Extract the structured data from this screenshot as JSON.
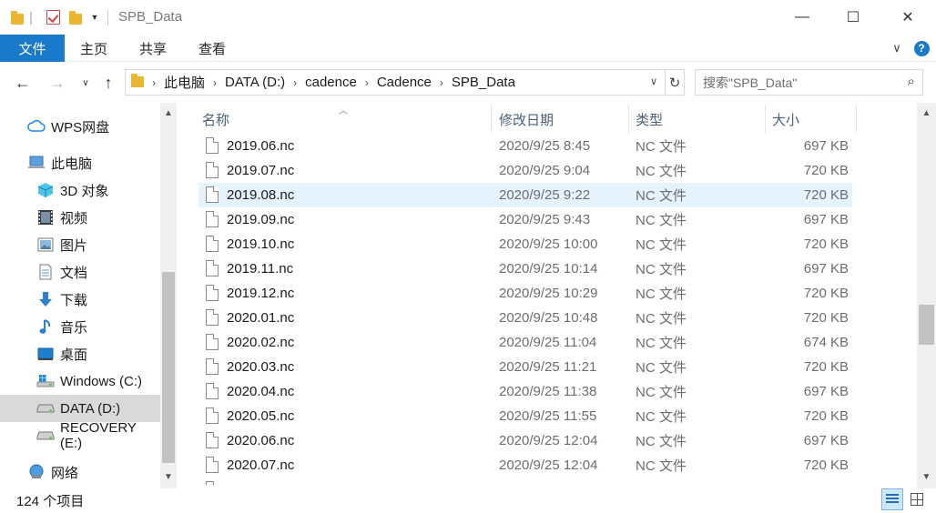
{
  "window": {
    "title": "SPB_Data",
    "minimize": "—",
    "maximize": "☐",
    "close": "✕"
  },
  "ribbon": {
    "file_tab": "文件",
    "tabs": [
      "主页",
      "共享",
      "查看"
    ],
    "expand": "∨",
    "help": "?"
  },
  "address": {
    "segments": [
      "此电脑",
      "DATA (D:)",
      "cadence",
      "Cadence",
      "SPB_Data"
    ],
    "search_placeholder": "搜索\"SPB_Data\""
  },
  "sidebar": {
    "items": [
      {
        "label": "WPS网盘",
        "icon": "cloud-icon"
      },
      {
        "label": "此电脑",
        "icon": "computer-icon"
      },
      {
        "label": "3D 对象",
        "icon": "cube-icon"
      },
      {
        "label": "视频",
        "icon": "video-icon"
      },
      {
        "label": "图片",
        "icon": "picture-icon"
      },
      {
        "label": "文档",
        "icon": "document-icon"
      },
      {
        "label": "下载",
        "icon": "download-icon"
      },
      {
        "label": "音乐",
        "icon": "music-icon"
      },
      {
        "label": "桌面",
        "icon": "desktop-icon"
      },
      {
        "label": "Windows (C:)",
        "icon": "windows-drive-icon"
      },
      {
        "label": "DATA (D:)",
        "icon": "drive-icon",
        "selected": true
      },
      {
        "label": "RECOVERY (E:)",
        "icon": "drive-icon"
      },
      {
        "label": "网络",
        "icon": "network-icon"
      }
    ]
  },
  "columns": {
    "name": "名称",
    "date": "修改日期",
    "type": "类型",
    "size": "大小"
  },
  "files": [
    {
      "name": "2019.06.nc",
      "date": "2020/9/25 8:45",
      "type": "NC 文件",
      "size": "697 KB"
    },
    {
      "name": "2019.07.nc",
      "date": "2020/9/25 9:04",
      "type": "NC 文件",
      "size": "720 KB"
    },
    {
      "name": "2019.08.nc",
      "date": "2020/9/25 9:22",
      "type": "NC 文件",
      "size": "720 KB",
      "hover": true
    },
    {
      "name": "2019.09.nc",
      "date": "2020/9/25 9:43",
      "type": "NC 文件",
      "size": "697 KB"
    },
    {
      "name": "2019.10.nc",
      "date": "2020/9/25 10:00",
      "type": "NC 文件",
      "size": "720 KB"
    },
    {
      "name": "2019.11.nc",
      "date": "2020/9/25 10:14",
      "type": "NC 文件",
      "size": "697 KB"
    },
    {
      "name": "2019.12.nc",
      "date": "2020/9/25 10:29",
      "type": "NC 文件",
      "size": "720 KB"
    },
    {
      "name": "2020.01.nc",
      "date": "2020/9/25 10:48",
      "type": "NC 文件",
      "size": "720 KB"
    },
    {
      "name": "2020.02.nc",
      "date": "2020/9/25 11:04",
      "type": "NC 文件",
      "size": "674 KB"
    },
    {
      "name": "2020.03.nc",
      "date": "2020/9/25 11:21",
      "type": "NC 文件",
      "size": "720 KB"
    },
    {
      "name": "2020.04.nc",
      "date": "2020/9/25 11:38",
      "type": "NC 文件",
      "size": "697 KB"
    },
    {
      "name": "2020.05.nc",
      "date": "2020/9/25 11:55",
      "type": "NC 文件",
      "size": "720 KB"
    },
    {
      "name": "2020.06.nc",
      "date": "2020/9/25 12:04",
      "type": "NC 文件",
      "size": "697 KB"
    },
    {
      "name": "2020.07.nc",
      "date": "2020/9/25 12:04",
      "type": "NC 文件",
      "size": "720 KB"
    }
  ],
  "status": {
    "item_count": "124 个项目"
  },
  "colors": {
    "accent": "#1979ca",
    "hover_row": "#e5f3ff",
    "selected_nav": "#d9d9d9",
    "header_text": "#4c607a"
  }
}
